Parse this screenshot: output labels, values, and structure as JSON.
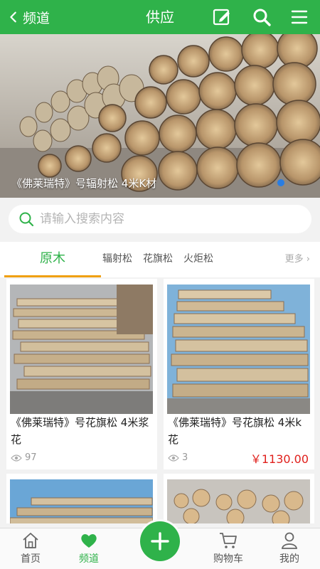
{
  "header": {
    "back_label": "频道",
    "title": "供应",
    "icons": [
      "back-chevron-icon",
      "edit-icon",
      "search-icon",
      "menu-icon"
    ]
  },
  "banner": {
    "caption": "《佛莱瑞特》号辐射松 4米K材",
    "indicator_color": "#2a7de1"
  },
  "search": {
    "placeholder": "请输入搜索内容"
  },
  "tabs": {
    "active": "原木",
    "items": [
      "辐射松",
      "花旗松",
      "火炬松"
    ],
    "more_label": "更多"
  },
  "products": [
    {
      "name": "《佛莱瑞特》号花旗松 4米浆花",
      "views": "97",
      "price": ""
    },
    {
      "name": "《佛莱瑞特》号花旗松 4米k花",
      "views": "3",
      "price": "￥1130.00"
    }
  ],
  "bottom_nav": {
    "home": "首页",
    "channel": "频道",
    "cart": "购物车",
    "mine": "我的"
  },
  "colors": {
    "brand": "#2fb24a",
    "tab_underline": "#f0a010",
    "price": "#e0201c"
  }
}
